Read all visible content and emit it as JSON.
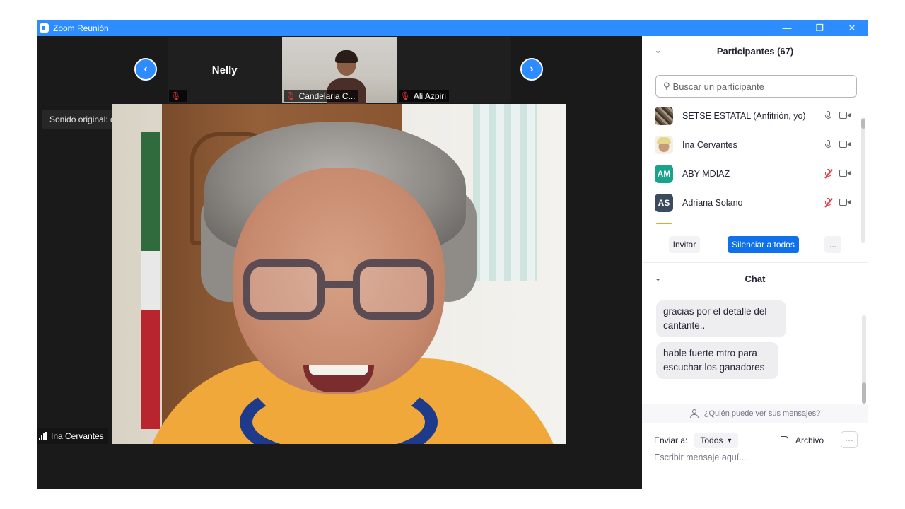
{
  "window": {
    "title": "Zoom Reunión",
    "controls": {
      "minimize": "—",
      "restore": "❐",
      "close": "✕"
    }
  },
  "gallery": {
    "prev_arrow": "‹",
    "next_arrow": "›",
    "thumbnails": [
      {
        "name": "Nelly",
        "label": "",
        "muted": true,
        "video": false
      },
      {
        "name": "",
        "label": "Candelaria C...",
        "muted": true,
        "video": true
      },
      {
        "name": "",
        "label": "Ali Azpiri",
        "muted": true,
        "video": false
      }
    ]
  },
  "original_sound": {
    "label": "Sonido original: desactivado",
    "caret": "▼"
  },
  "active_speaker": {
    "name": "Ina Cervantes"
  },
  "participants": {
    "title": "Participantes (67)",
    "search_placeholder": "Buscar un participante",
    "list": [
      {
        "name": "SETSE ESTATAL (Anfitrión, yo)",
        "avatar": "",
        "avatar_color": "#6b5a48",
        "mic_muted": false
      },
      {
        "name": "Ina Cervantes",
        "avatar": "",
        "avatar_color": "#f5f0e6",
        "mic_muted": false
      },
      {
        "name": "ABY MDIAZ",
        "avatar": "AM",
        "avatar_color": "#1aa38a",
        "mic_muted": true
      },
      {
        "name": "Adriana Solano",
        "avatar": "AS",
        "avatar_color": "#3b4a5e",
        "mic_muted": true
      }
    ],
    "partial_avatar_color": "#f2a51c",
    "invite_label": "Invitar",
    "mute_all_label": "Silenciar a todos",
    "more_label": "..."
  },
  "chat": {
    "title": "Chat",
    "messages": [
      {
        "text": "gracias por el detalle del cantante.."
      },
      {
        "text": "hable fuerte mtro para escuchar los ganadores"
      }
    ],
    "visibility_text": "¿Quién puede ver sus mensajes?",
    "send_to_label": "Enviar a:",
    "send_to_value": "Todos",
    "file_label": "Archivo",
    "more_label": "···",
    "input_placeholder": "Escribir mensaje aquí..."
  },
  "colors": {
    "accent": "#2d8cff",
    "primary_button": "#0e71eb",
    "muted_red": "#e0383e"
  }
}
